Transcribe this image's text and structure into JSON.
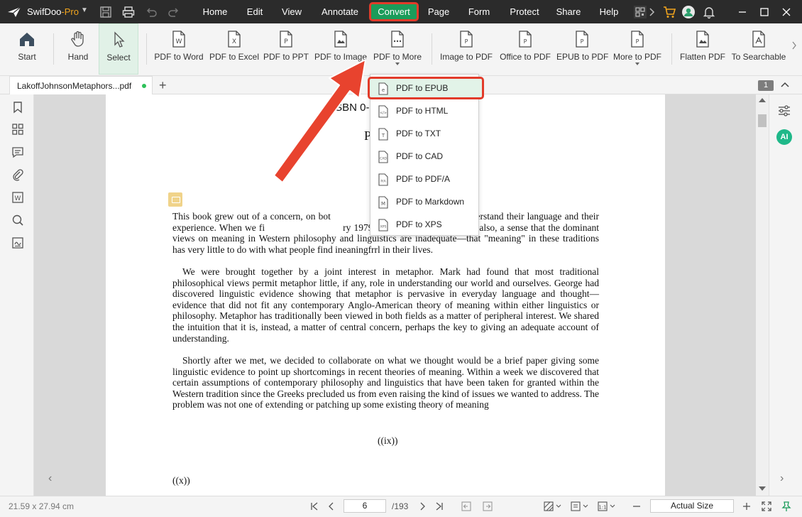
{
  "app": {
    "name": "SwifDoo",
    "edition": "-Pro",
    "accent_color": "#1b9c5a",
    "highlight_color": "#e23b2a"
  },
  "menu": {
    "items": [
      "Home",
      "Edit",
      "View",
      "Annotate",
      "Convert",
      "Page",
      "Form",
      "Protect",
      "Share",
      "Help"
    ],
    "active": "Convert"
  },
  "ribbon": {
    "start": "Start",
    "hand": "Hand",
    "select": "Select",
    "pdf_to_word": "PDF to Word",
    "pdf_to_excel": "PDF to Excel",
    "pdf_to_ppt": "PDF to PPT",
    "pdf_to_image": "PDF to Image",
    "pdf_to_more": "PDF to More",
    "image_to_pdf": "Image to PDF",
    "office_to_pdf": "Office to PDF",
    "epub_to_pdf": "EPUB to PDF",
    "more_to_pdf": "More to PDF",
    "flatten_pdf": "Flatten PDF",
    "to_searchable": "To Searchable"
  },
  "dropdown": {
    "items": [
      {
        "label": "PDF to EPUB",
        "icon": "epub-file-icon"
      },
      {
        "label": "PDF to HTML",
        "icon": "html-file-icon"
      },
      {
        "label": "PDF to TXT",
        "icon": "txt-file-icon"
      },
      {
        "label": "PDF to CAD",
        "icon": "cad-file-icon"
      },
      {
        "label": "PDF to PDF/A",
        "icon": "pdfa-file-icon"
      },
      {
        "label": "PDF to Markdown",
        "icon": "markdown-file-icon"
      },
      {
        "label": "PDF to XPS",
        "icon": "xps-file-icon"
      }
    ],
    "highlighted": "PDF to EPUB"
  },
  "tab": {
    "filename": "LakoffJohnsonMetaphors...pdf",
    "add": "+",
    "page_badge": "1"
  },
  "document": {
    "isbn": "ISBN 0-",
    "header": "P",
    "paragraphs": [
      "This book grew out of a concern, on bot",
      " people understand their language and their experience. When we fi",
      "ry 1979, we found that we shared, also, a sense that the dominant views on meaning in Western philosophy and linguistics are inadequate—that \"meaning\" in these traditions has very little to do with what people find ineaningfrrl in their lives.",
      "We were brought together by a joint interest in metaphor. Mark had found that most traditional philosophical views permit metaphor little, if any, role in understanding our world and ourselves. George had discovered linguistic evidence showing that metaphor is pervasive in everyday language and thought—evidence that did not fit any contemporary Anglo-American theory of meaning within either linguistics or philosophy. Metaphor has traditionally been viewed in both fields as a matter of peripheral interest. We shared the intuition that it is, instead, a matter of central concern, perhaps the key to giving an adequate account of understanding.",
      "Shortly after we met, we decided to collaborate on what we thought would be a brief paper giving some linguistic evidence to point up shortcomings in recent theories of meaning. Within a week we discovered that certain assumptions of contemporary philosophy and linguistics that have been taken for granted within the Western tradition since the Greeks precluded us from even raising the kind of issues we wanted to address. The problem was not one of extending or patching up some existing theory of meaning"
    ],
    "page_roman_1": "((ix))",
    "page_roman_2": "((x))"
  },
  "rightbar": {
    "ai": "AI"
  },
  "status": {
    "dimensions": "21.59 x 27.94 cm",
    "current_page": "6",
    "total_pages": "/193",
    "zoom": "Actual Size"
  }
}
